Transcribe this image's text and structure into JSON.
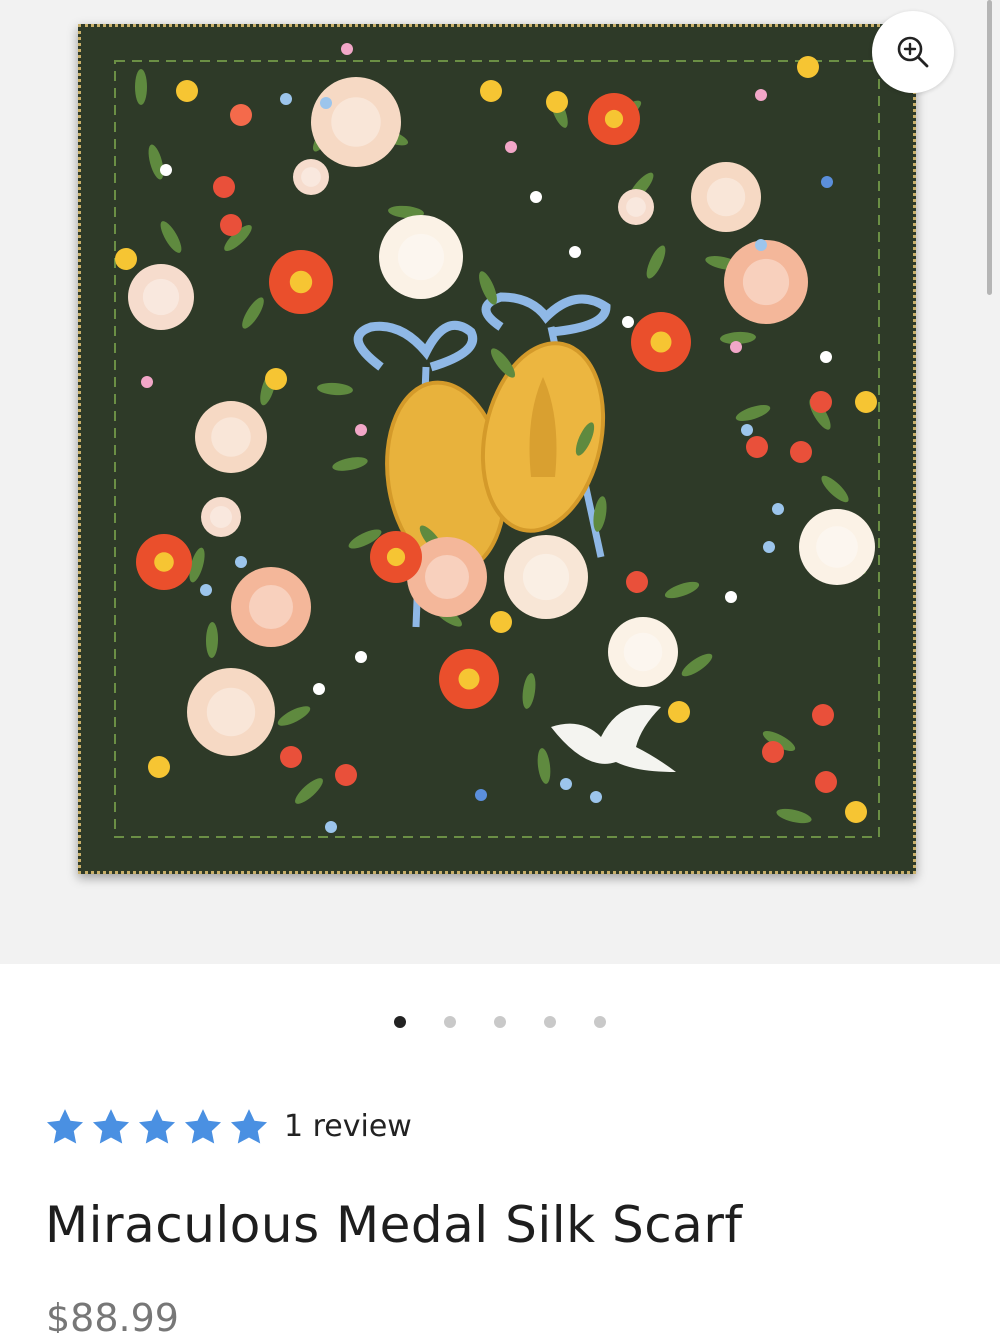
{
  "product": {
    "image_alt": "Miraculous Medal Silk Scarf",
    "title": "Miraculous Medal Silk Scarf",
    "price": "$88.99",
    "rating": {
      "stars": 5,
      "max_stars": 5,
      "star_color": "#4a90e2",
      "review_count_label": "1 review"
    }
  },
  "gallery": {
    "total_images": 5,
    "active_index": 0,
    "zoom_icon": "zoom-in-icon"
  },
  "colors": {
    "scarf_background": "#2e3a28",
    "accent_star": "#4a90e2",
    "dot_active": "#222222",
    "dot_inactive": "#c9c9c9"
  }
}
